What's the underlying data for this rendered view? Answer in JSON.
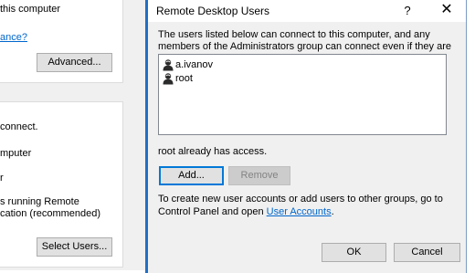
{
  "background_window": {
    "assist_group": {
      "text_line": "this computer",
      "link_fragment": "ance?",
      "advanced_button": "Advanced..."
    },
    "remote_group": {
      "line_connect": "connect.",
      "line_computer": "mputer",
      "line_r": "r",
      "line_running": "s running Remote",
      "line_recommended": "cation (recommended)",
      "select_users_button": "Select Users..."
    }
  },
  "dialog": {
    "title": "Remote Desktop Users",
    "help_glyph": "?",
    "close_glyph": "✕",
    "description": "The users listed below can connect to this computer, and any members of the Administrators group can connect even if they are not listed.",
    "users": [
      {
        "name": "a.ivanov",
        "icon": "user-icon"
      },
      {
        "name": "root",
        "icon": "user-icon"
      }
    ],
    "access_status": "root already has access.",
    "add_button": "Add...",
    "remove_button": "Remove",
    "info_text_prefix": "To create new user accounts or add users to other groups, go to Control Panel and open ",
    "info_link": "User Accounts",
    "info_text_suffix": ".",
    "ok_button": "OK",
    "cancel_button": "Cancel"
  },
  "colors": {
    "accent_border": "#1f6fc5",
    "link": "#0066cc",
    "focus": "#0078d7"
  }
}
